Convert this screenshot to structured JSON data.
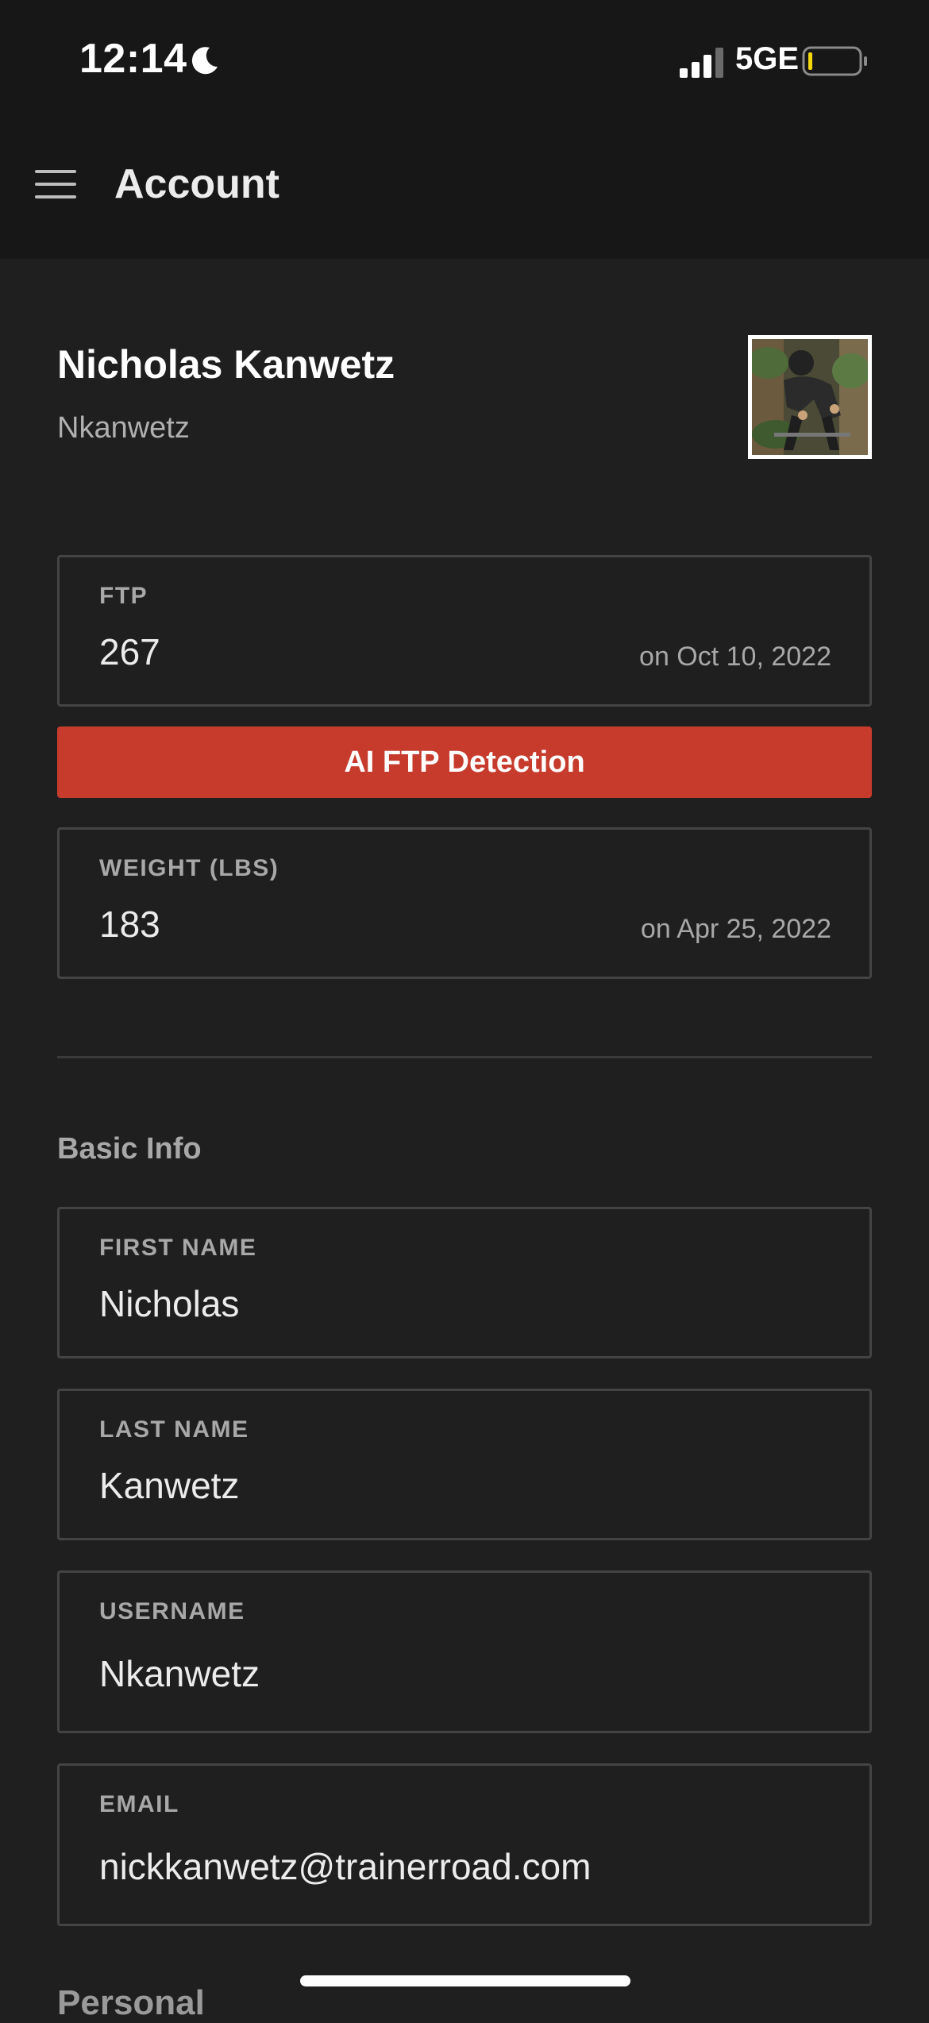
{
  "status_bar": {
    "time": "12:14",
    "network": "5GE",
    "icons": [
      "moon-icon",
      "signal-icon",
      "battery-icon"
    ],
    "battery_level_fraction": 0.05
  },
  "header": {
    "title": "Account",
    "menu_icon": "hamburger-menu-icon"
  },
  "profile": {
    "name": "Nicholas Kanwetz",
    "username": "Nkanwetz"
  },
  "metrics": {
    "ftp": {
      "label": "FTP",
      "value": "267",
      "date": "on Oct 10, 2022"
    },
    "ai_ftp_button": "AI FTP Detection",
    "weight": {
      "label": "WEIGHT (LBS)",
      "value": "183",
      "date": "on Apr 25, 2022"
    }
  },
  "basic_info": {
    "heading": "Basic Info",
    "fields": [
      {
        "label": "FIRST NAME",
        "value": "Nicholas"
      },
      {
        "label": "LAST NAME",
        "value": "Kanwetz"
      },
      {
        "label": "USERNAME",
        "value": "Nkanwetz"
      },
      {
        "label": "EMAIL",
        "value": "nickkanwetz@trainerroad.com"
      }
    ]
  },
  "next_section_partial": "Personal",
  "colors": {
    "accent_red": "#c73b2d",
    "background": "#1f1f1f",
    "header_background": "#171717",
    "border": "#444444"
  }
}
